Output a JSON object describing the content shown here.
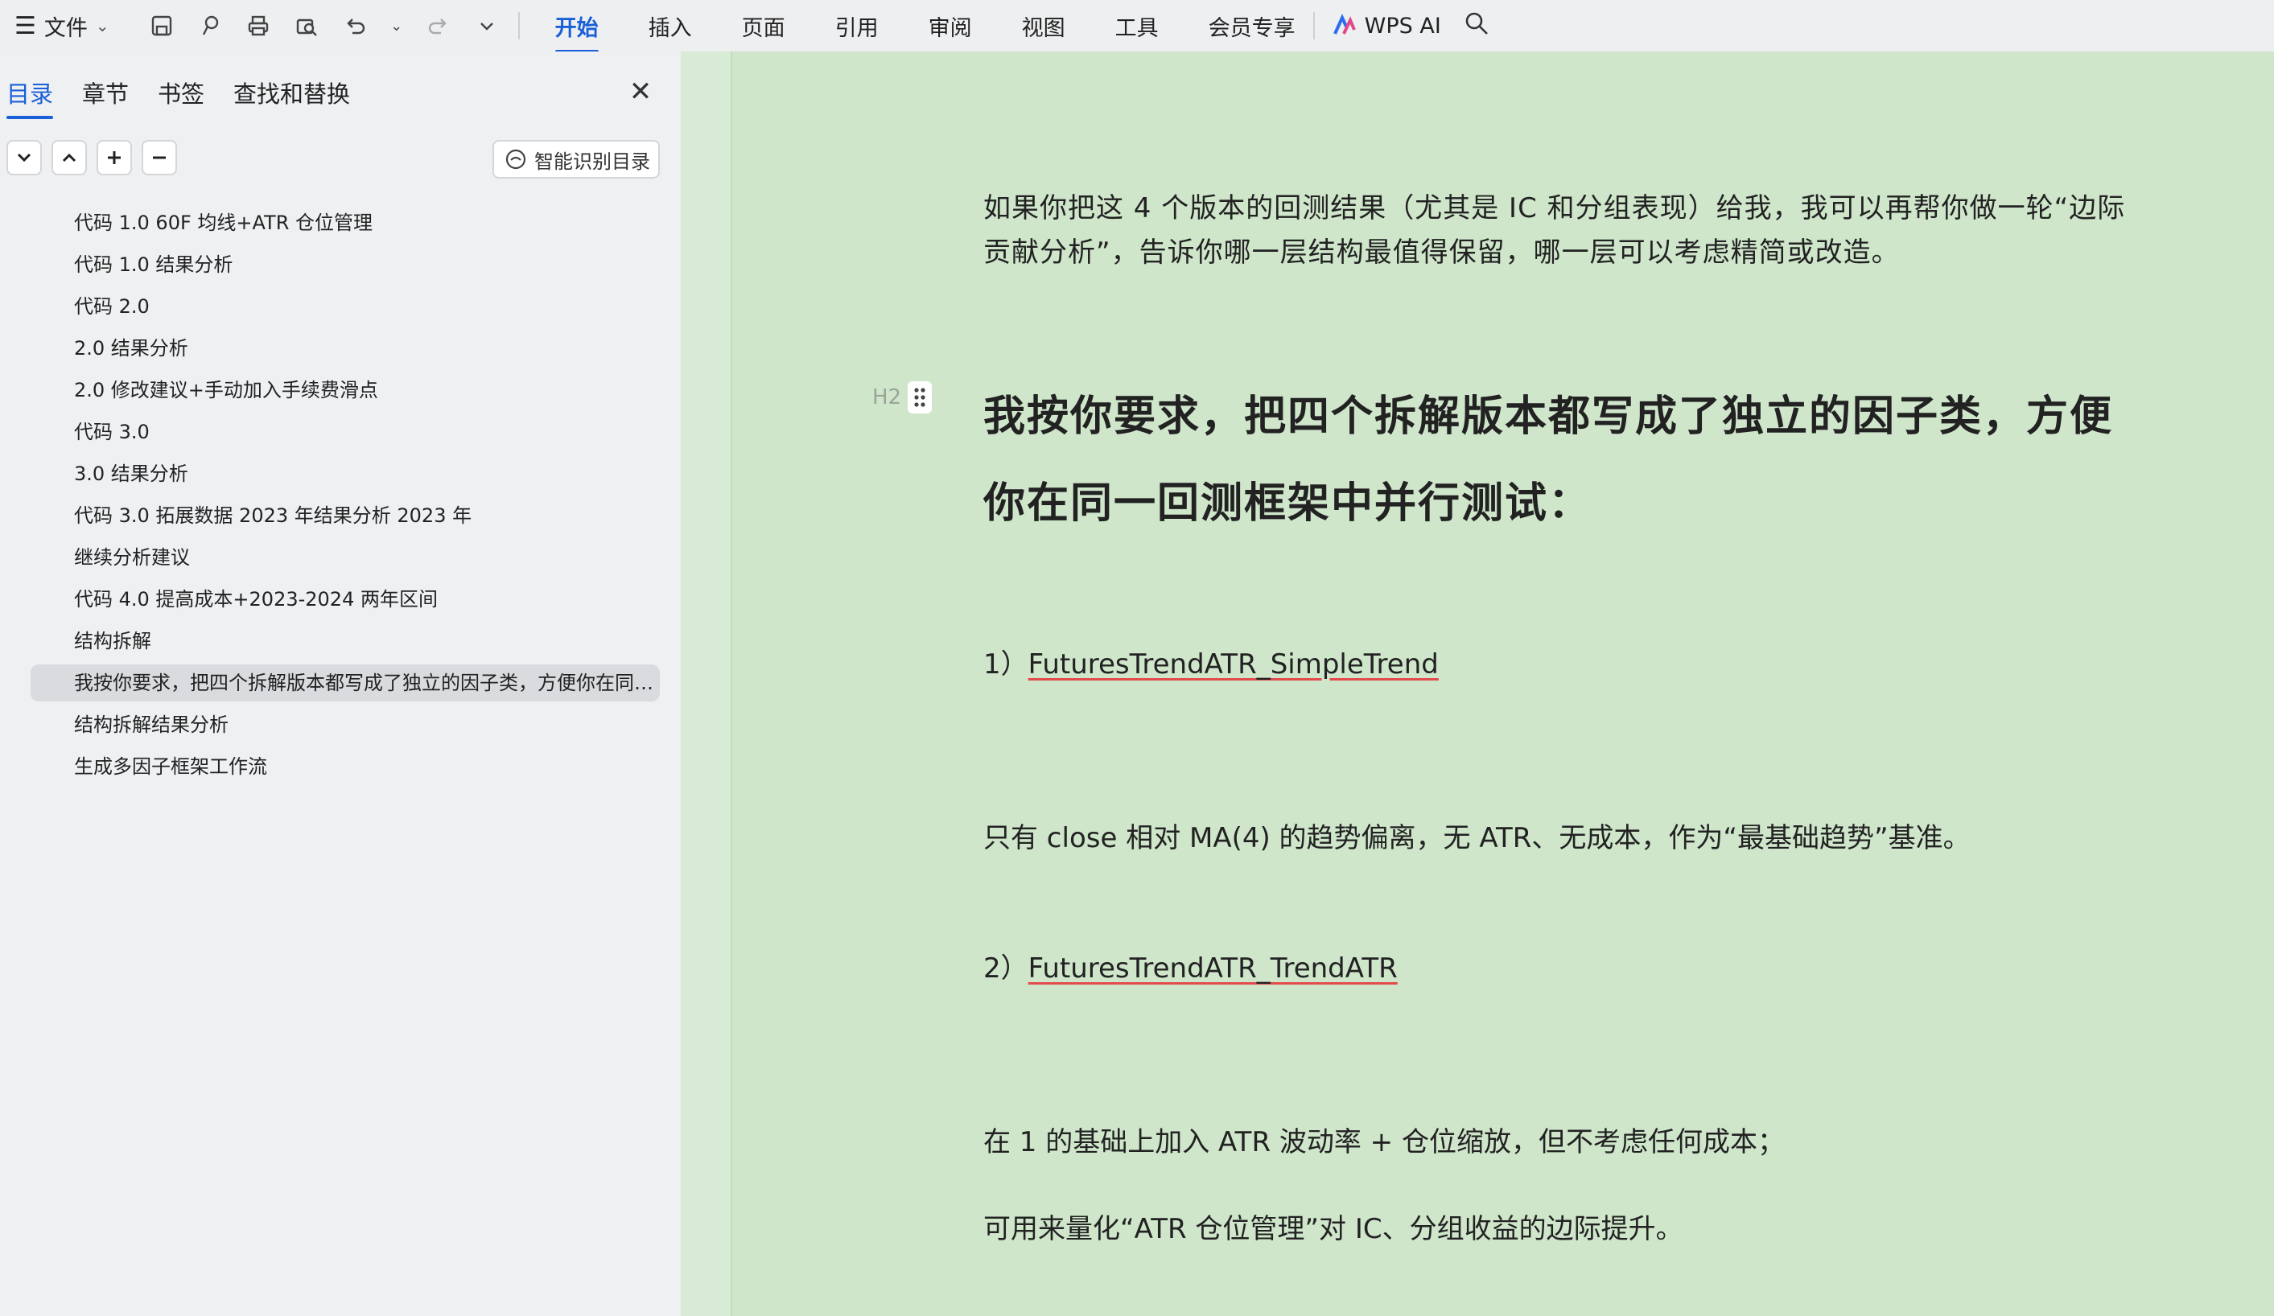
{
  "toolbar": {
    "file_label": "文件",
    "tabs": [
      "开始",
      "插入",
      "页面",
      "引用",
      "审阅",
      "视图",
      "工具",
      "会员专享"
    ],
    "ai_label": "WPS AI",
    "accent": "#1a5fd8"
  },
  "sidebar": {
    "tabs": [
      "目录",
      "章节",
      "书签",
      "查找和替换"
    ],
    "smart_toc_label": "智能识别目录",
    "toc": [
      "代码 1.0 60F 均线+ATR 仓位管理",
      "代码 1.0 结果分析",
      "代码 2.0",
      "2.0 结果分析",
      "2.0 修改建议+手动加入手续费滑点",
      "代码 3.0",
      "3.0 结果分析",
      "代码 3.0 拓展数据 2023 年结果分析 2023 年",
      "继续分析建议",
      "代码 4.0  提高成本+2023-2024 两年区间",
      "结构拆解",
      "我按你要求，把四个拆解版本都写成了独立的因子类，方便你在同一回测框架中并行测试：",
      "结构拆解结果分析",
      "生成多因子框架工作流"
    ],
    "active_index": 11
  },
  "document": {
    "intro": "如果你把这 4 个版本的回测结果（尤其是 IC 和分组表现）给我，我可以再帮你做一轮“边际贡献分析”，告诉你哪一层结构最值得保留，哪一层可以考虑精简或改造。",
    "heading_marker": "H2",
    "heading": "我按你要求，把四个拆解版本都写成了独立的因子类，方便你在同一回测框架中并行测试：",
    "item1_prefix": "1）",
    "item1_name": "FuturesTrendATR_SimpleTrend",
    "item1_desc": "只有 close 相对 MA(4) 的趋势偏离，无 ATR、无成本，作为“最基础趋势”基准。",
    "item2_prefix": "2）",
    "item2_name": "FuturesTrendATR_TrendATR",
    "item2_desc1": "在 1 的基础上加入 ATR 波动率 + 仓位缩放，但不考虑任何成本；",
    "item2_desc2": "可用来量化“ATR 仓位管理”对 IC、分组收益的边际提升。",
    "bg_color": "#cfe6cb"
  }
}
